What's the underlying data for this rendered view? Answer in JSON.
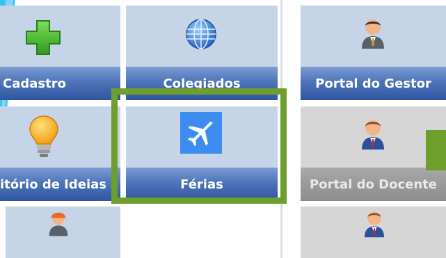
{
  "tiles": [
    {
      "label": "Cadastro",
      "icon": "green-plus-icon"
    },
    {
      "label": "Colegiados",
      "icon": "globe-icon"
    },
    {
      "label": "Portal do Gestor",
      "icon": "manager-person-icon"
    },
    {
      "label": "itório de Ideias",
      "icon": "lightbulb-icon"
    },
    {
      "label": "Férias",
      "icon": "airplane-icon"
    },
    {
      "label": "Portal do Docente",
      "icon": "teacher-person-icon"
    },
    {
      "label": "",
      "icon": "worker-person-icon"
    },
    {
      "label": "",
      "icon": "person-icon"
    }
  ],
  "colors": {
    "tile_bg": "#c5d4e6",
    "tile_disabled_bg": "#d6d6d6",
    "label_bar": "#3f63aa",
    "highlight": "#6e9f2c",
    "accent": "#35c3f0"
  }
}
